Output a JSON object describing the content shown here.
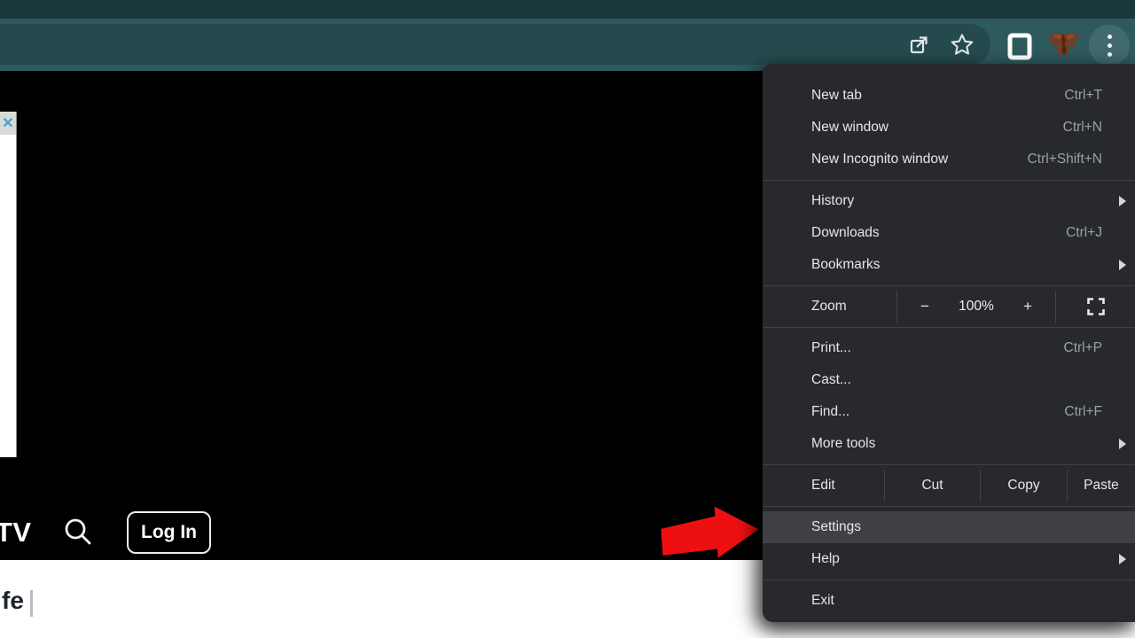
{
  "browser_menu": {
    "items": [
      {
        "label": "New tab",
        "shortcut": "Ctrl+T"
      },
      {
        "label": "New window",
        "shortcut": "Ctrl+N"
      },
      {
        "label": "New Incognito window",
        "shortcut": "Ctrl+Shift+N"
      },
      {
        "label": "History",
        "submenu": true
      },
      {
        "label": "Downloads",
        "shortcut": "Ctrl+J"
      },
      {
        "label": "Bookmarks",
        "submenu": true
      },
      {
        "label": "Print...",
        "shortcut": "Ctrl+P"
      },
      {
        "label": "Cast..."
      },
      {
        "label": "Find...",
        "shortcut": "Ctrl+F"
      },
      {
        "label": "More tools",
        "submenu": true
      },
      {
        "label": "Settings",
        "highlighted": true
      },
      {
        "label": "Help",
        "submenu": true
      },
      {
        "label": "Exit"
      }
    ],
    "zoom_row": {
      "label": "Zoom",
      "decrease": "−",
      "level": "100%",
      "increase": "+"
    },
    "edit_row": {
      "label": "Edit",
      "cut": "Cut",
      "copy": "Copy",
      "paste": "Paste"
    }
  },
  "toolbar": {
    "icons": [
      "share-icon",
      "bookmark-star-icon",
      "side-panel-icon",
      "profile-avatar",
      "three-dot-menu-icon"
    ]
  },
  "page": {
    "nav_brand": "TV",
    "login_label": "Log In",
    "footer_fragment": "fe",
    "footer_divider": "|",
    "popup_close": "✕"
  },
  "annotation": {
    "type": "red-arrow-pointing-right",
    "target": "Settings"
  },
  "colors": {
    "toolbar_teal": "#2e5a5e",
    "tabstrip_teal": "#1a383c",
    "omnibox_teal": "#254a4e",
    "menu_button_circle": "#406a6e",
    "menu_bg": "#28292c",
    "menu_highlight": "#3e4043",
    "menu_text": "#e4e6e9",
    "menu_shortcut_text": "#9aa0a6",
    "separator": "#404247",
    "arrow_red": "#ee1010",
    "popup_close_blue": "#3ca3c9"
  }
}
